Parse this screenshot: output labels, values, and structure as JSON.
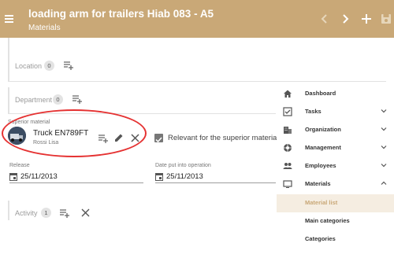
{
  "header": {
    "title": "loading arm for trailers Hiab 083 - A5",
    "subtitle": "Materials",
    "icons": [
      "menu-icon",
      "chevron-left-icon",
      "chevron-right-icon",
      "plus-icon",
      "save-icon"
    ]
  },
  "form": {
    "location": {
      "label": "Location",
      "count": "0"
    },
    "department": {
      "label": "Department",
      "count": "0"
    },
    "superior_material": {
      "label": "Superior material",
      "name": "Truck EN789FT",
      "owner": "Rossi Lisa"
    },
    "relevant_checkbox": {
      "label": "Relevant for the superior material",
      "checked": true
    },
    "release": {
      "label": "Release",
      "value": "25/11/2013"
    },
    "date_put_into_operation": {
      "label": "Date put into operation",
      "value": "25/11/2013"
    },
    "activity": {
      "label": "Activity",
      "count": "1"
    }
  },
  "menu": {
    "items": [
      {
        "label": "Dashboard",
        "icon": "home-icon",
        "expandable": false
      },
      {
        "label": "Tasks",
        "icon": "checkbox-icon",
        "expandable": true
      },
      {
        "label": "Organization",
        "icon": "building-icon",
        "expandable": true
      },
      {
        "label": "Management",
        "icon": "aperture-icon",
        "expandable": true
      },
      {
        "label": "Employees",
        "icon": "people-icon",
        "expandable": true
      },
      {
        "label": "Materials",
        "icon": "monitor-icon",
        "expandable": true,
        "expanded": true
      }
    ],
    "subitems": [
      {
        "label": "Material list",
        "active": true
      },
      {
        "label": "Main categories",
        "active": false
      },
      {
        "label": "Categories",
        "active": false
      }
    ]
  },
  "colors": {
    "accent": "#c9a877",
    "annotation": "#e53232"
  }
}
